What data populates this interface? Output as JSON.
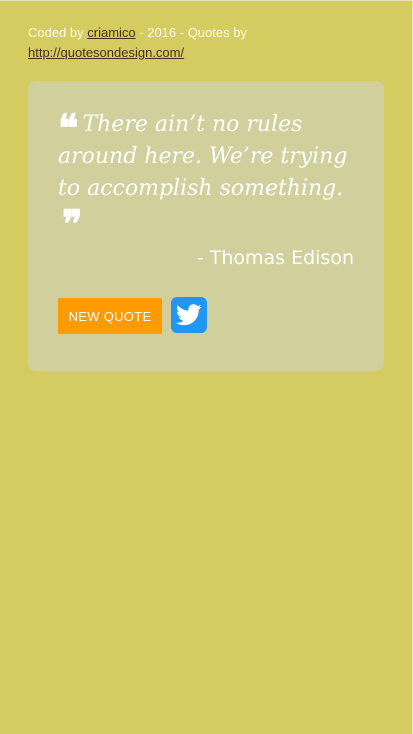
{
  "credits": {
    "prefix": "Coded by ",
    "author_link": "criamico",
    "middle": " - 2016 - Quotes by",
    "source_link": "http://quotesondesign.com/"
  },
  "quote": {
    "text": "There ain’t no rules around here. We’re trying to accomplish something.",
    "open_mark": "❝",
    "close_mark": "❞",
    "author": "- Thomas Edison"
  },
  "buttons": {
    "new_quote": "NEW QUOTE",
    "tweet_icon": "twitter-bird"
  },
  "colors": {
    "background": "#d4cb61",
    "card": "#d1cf9b",
    "new_quote_button": "#ff9a00",
    "tweet_button": "#2196f3"
  }
}
